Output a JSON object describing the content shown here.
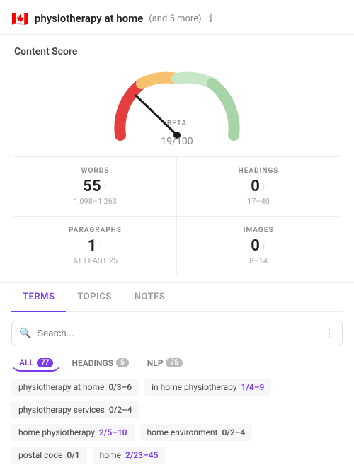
{
  "header": {
    "flag": "🇨🇦",
    "title": "physiotherapy at home",
    "more": "(and 5 more)",
    "info_icon": "ℹ"
  },
  "content_score": {
    "title": "Content Score",
    "beta_label": "BETA",
    "score": "19",
    "score_suffix": "/100"
  },
  "stats": [
    {
      "label": "WORDS",
      "value": "55",
      "range": "1,098–1,263",
      "has_arrow": true
    },
    {
      "label": "HEADINGS",
      "value": "0",
      "range": "17–40",
      "has_arrow": true
    },
    {
      "label": "PARAGRAPHS",
      "value": "1",
      "range": "AT LEAST 25",
      "has_arrow": true
    },
    {
      "label": "IMAGES",
      "value": "0",
      "range": "8–14",
      "has_arrow": true
    }
  ],
  "tabs": [
    {
      "label": "TERMS",
      "active": true
    },
    {
      "label": "TOPICS",
      "active": false
    },
    {
      "label": "NOTES",
      "active": false
    }
  ],
  "search": {
    "placeholder": "Search..."
  },
  "filter_tabs": [
    {
      "label": "ALL",
      "badge": "77",
      "active": true
    },
    {
      "label": "HEADINGS",
      "badge": "5",
      "active": false
    },
    {
      "label": "NLP",
      "badge": "75",
      "active": false
    }
  ],
  "terms": [
    {
      "name": "physiotherapy at home",
      "count": "0/3–6"
    },
    {
      "name": "in home physiotherapy",
      "count": "1/4–9",
      "highlight": true
    },
    {
      "name": "physiotherapy services",
      "count": "0/2–4"
    },
    {
      "name": "home physiotherapy",
      "count": "2/5–10",
      "highlight": true
    },
    {
      "name": "home environment",
      "count": "0/2–4"
    },
    {
      "name": "postal code",
      "count": "0/1"
    },
    {
      "name": "home",
      "count": "2/23–45",
      "highlight": true
    }
  ]
}
